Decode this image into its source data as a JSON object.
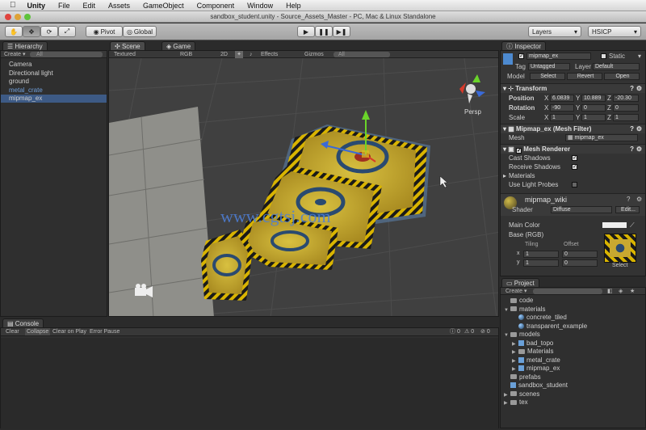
{
  "menubar": {
    "apple": "",
    "app": "Unity",
    "items": [
      "File",
      "Edit",
      "Assets",
      "GameObject",
      "Component",
      "Window",
      "Help"
    ]
  },
  "window": {
    "title": "sandbox_student.unity - Source_Assets_Master - PC, Mac & Linux Standalone"
  },
  "toolbar": {
    "pivot": "Pivot",
    "global": "Global",
    "layers": "Layers",
    "layout": "HSICP"
  },
  "hierarchy": {
    "tab": "Hierarchy",
    "create": "Create",
    "search": "All",
    "items": [
      {
        "label": "Camera",
        "color": "#d0d0d0"
      },
      {
        "label": "Directional light",
        "color": "#d0d0d0"
      },
      {
        "label": "ground",
        "color": "#d0d0d0"
      },
      {
        "label": "metal_crate",
        "color": "#6f9fdc"
      },
      {
        "label": "mipmap_ex",
        "color": "#d0d0d0"
      }
    ]
  },
  "scene": {
    "tab_scene": "Scene",
    "tab_game": "Game",
    "shading": "Textured",
    "render": "RGB",
    "mode2d": "2D",
    "effects": "Effects",
    "gizmos": "Gizmos",
    "search": "All",
    "persp": "Persp",
    "watermark": "www.cgtsj.com"
  },
  "inspector": {
    "tab": "Inspector",
    "name": "mipmap_ex",
    "static": "Static",
    "tag_label": "Tag",
    "tag": "Untagged",
    "layer_label": "Layer",
    "layer": "Default",
    "model_label": "Model",
    "select": "Select",
    "revert": "Revert",
    "open": "Open",
    "transform": "Transform",
    "position_label": "Position",
    "pos": {
      "x": "6.0839",
      "y": "10.889",
      "z": "-20.30"
    },
    "rotation_label": "Rotation",
    "rot": {
      "x": "-90",
      "y": "0",
      "z": "0"
    },
    "scale_label": "Scale",
    "scl": {
      "x": "1",
      "y": "1",
      "z": "1"
    },
    "mesh_filter": "Mipmap_ex (Mesh Filter)",
    "mesh_label": "Mesh",
    "mesh": "mipmap_ex",
    "mesh_renderer": "Mesh Renderer",
    "cast": "Cast Shadows",
    "receive": "Receive Shadows",
    "materials": "Materials",
    "light_probes": "Use Light Probes",
    "material": "mipmap_wiki",
    "shader_label": "Shader",
    "shader": "Diffuse",
    "edit": "Edit...",
    "main_color": "Main Color",
    "base": "Base (RGB)",
    "tiling": "Tiling",
    "offset": "Offset",
    "tx": "1",
    "ty": "1",
    "ox": "0",
    "oy": "0",
    "select_tex": "Select"
  },
  "project": {
    "tab": "Project",
    "create": "Create",
    "items": [
      {
        "label": "code",
        "depth": 0,
        "type": "folder",
        "arrow": ""
      },
      {
        "label": "materials",
        "depth": 0,
        "type": "folder",
        "arrow": "▼"
      },
      {
        "label": "concrete_tiled",
        "depth": 1,
        "type": "mat",
        "arrow": ""
      },
      {
        "label": "transparent_example",
        "depth": 1,
        "type": "mat",
        "arrow": ""
      },
      {
        "label": "models",
        "depth": 0,
        "type": "folder",
        "arrow": "▼"
      },
      {
        "label": "bad_topo",
        "depth": 1,
        "type": "cube",
        "arrow": "▶"
      },
      {
        "label": "Materials",
        "depth": 1,
        "type": "folder",
        "arrow": "▶"
      },
      {
        "label": "metal_crate",
        "depth": 1,
        "type": "cube",
        "arrow": "▶"
      },
      {
        "label": "mipmap_ex",
        "depth": 1,
        "type": "cube",
        "arrow": "▶"
      },
      {
        "label": "prefabs",
        "depth": 0,
        "type": "folder",
        "arrow": ""
      },
      {
        "label": "sandbox_student",
        "depth": 0,
        "type": "scene",
        "arrow": ""
      },
      {
        "label": "scenes",
        "depth": 0,
        "type": "folder",
        "arrow": "▶"
      },
      {
        "label": "tex",
        "depth": 0,
        "type": "folder",
        "arrow": "▶"
      }
    ]
  },
  "console": {
    "tab": "Console",
    "clear": "Clear",
    "collapse": "Collapse",
    "clear_on_play": "Clear on Play",
    "error_pause": "Error Pause",
    "count_info": "0",
    "count_warn": "0",
    "count_err": "0"
  }
}
